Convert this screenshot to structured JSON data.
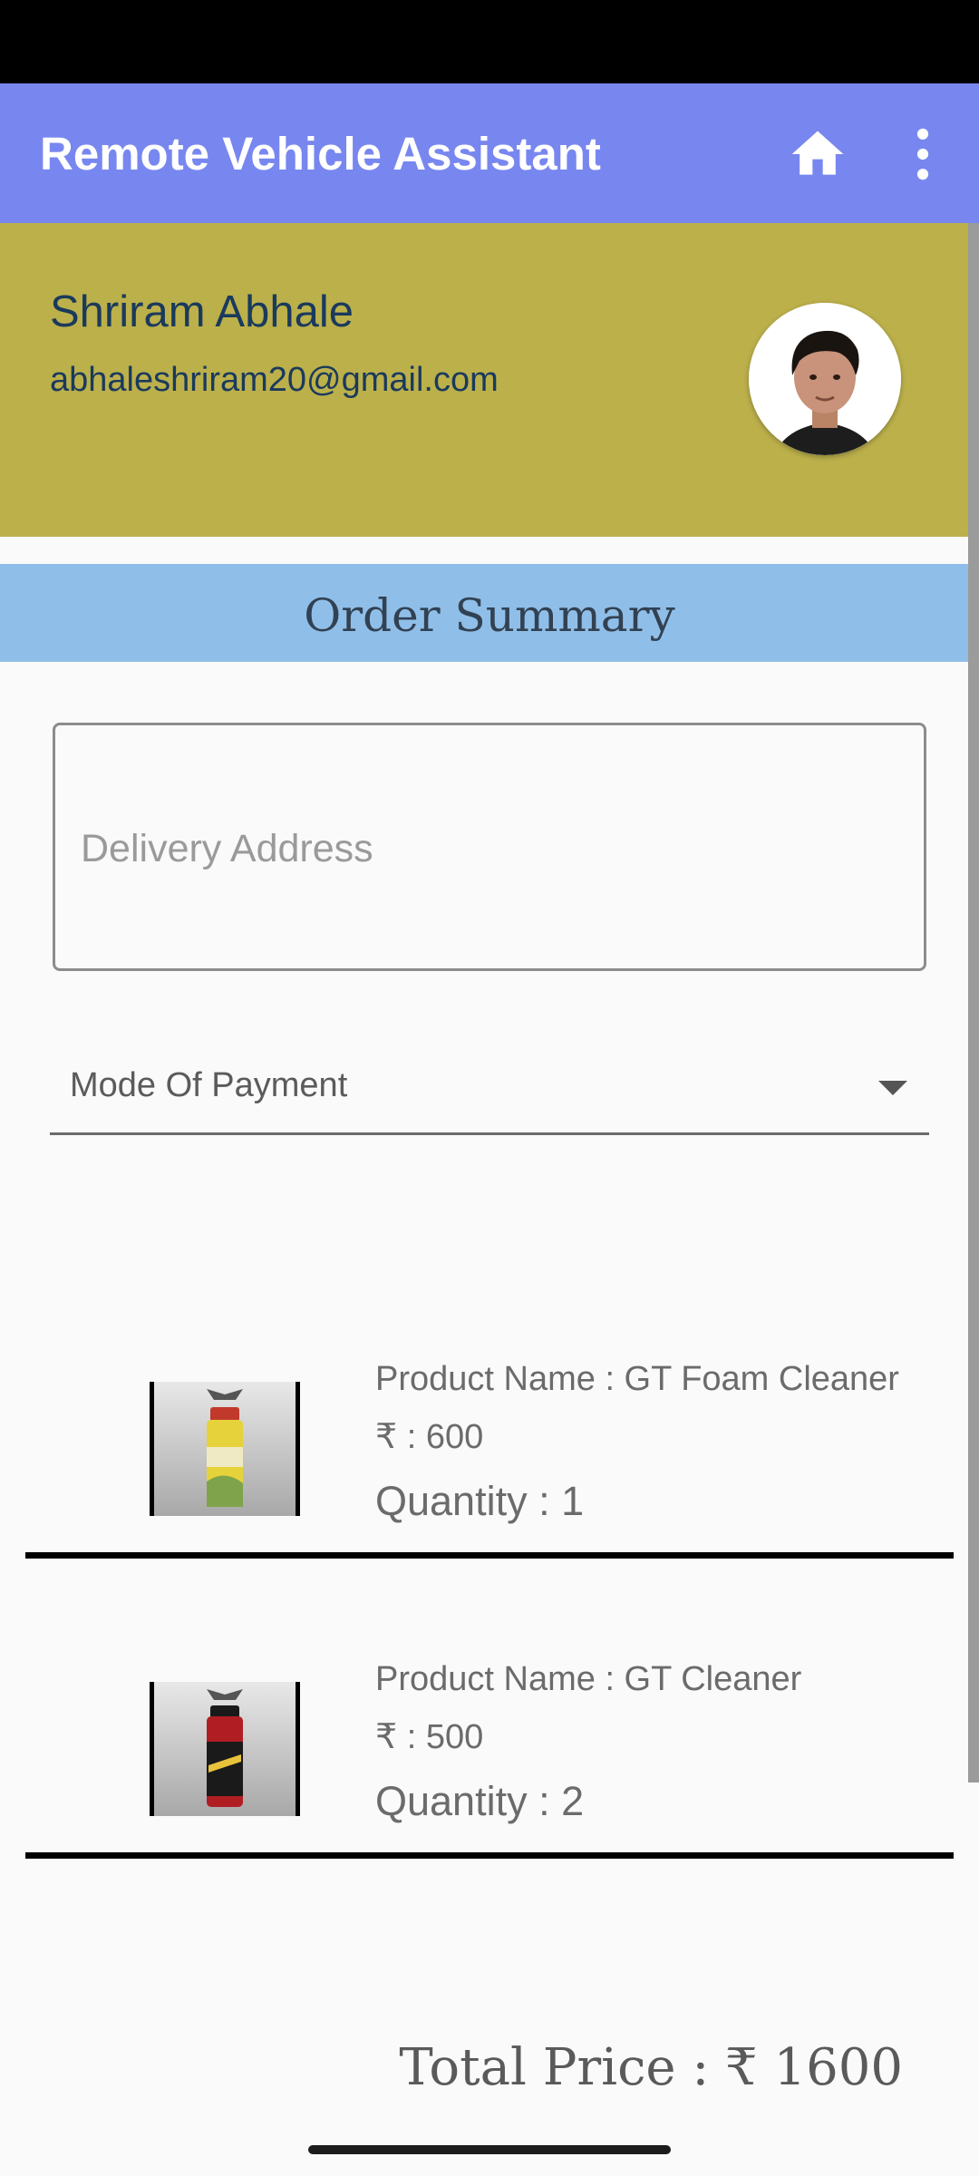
{
  "app_bar": {
    "title": "Remote Vehicle Assistant",
    "home_icon": "home-icon",
    "more_icon": "more-vert-icon",
    "color": "#7887ef"
  },
  "profile": {
    "name": "Shriram Abhale",
    "email": "abhaleshriram20@gmail.com",
    "background": "#bcb04b"
  },
  "section": {
    "title": "Order Summary",
    "background": "#8fbfe9"
  },
  "form": {
    "address_placeholder": "Delivery Address",
    "payment_label": "Mode Of Payment",
    "dropdown_icon": "dropdown-arrow-icon"
  },
  "products": [
    {
      "name": "Product Name : GT Foam Cleaner",
      "price": "₹ : 600",
      "quantity": "Quantity : 1",
      "can_color": "#e6d23a",
      "cap_color": "#c0392b"
    },
    {
      "name": "Product Name : GT Cleaner",
      "price": "₹ : 500",
      "quantity": "Quantity : 2",
      "can_color": "#b01e24",
      "cap_color": "#1a1a1a"
    }
  ],
  "total": "Total Price : ₹ 1600"
}
